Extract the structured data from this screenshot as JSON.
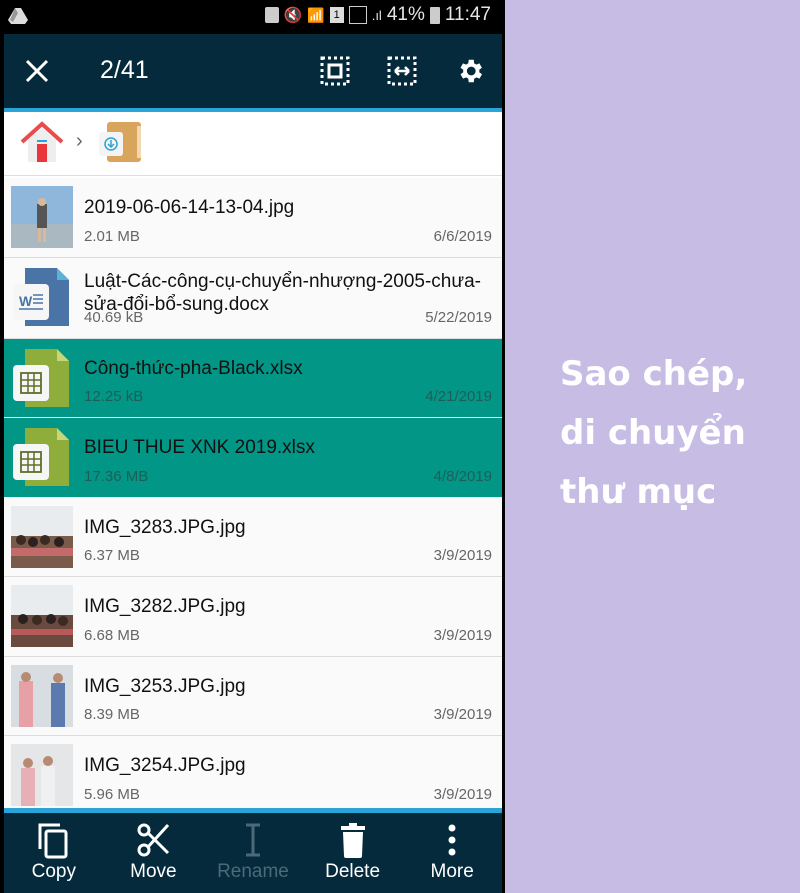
{
  "status_bar": {
    "battery": "41%",
    "time": "11:47"
  },
  "toolbar": {
    "counter": "2/41"
  },
  "files": [
    {
      "name": "2019-06-06-14-13-04.jpg",
      "size": "2.01 MB",
      "date": "6/6/2019",
      "type": "image",
      "selected": false
    },
    {
      "name": "Luật-Các-công-cụ-chuyển-nhượng-2005-chưa-sửa-đổi-bổ-sung.docx",
      "size": "40.69 kB",
      "date": "5/22/2019",
      "type": "word",
      "selected": false
    },
    {
      "name": "Công-thức-pha-Black.xlsx",
      "size": "12.25 kB",
      "date": "4/21/2019",
      "type": "excel",
      "selected": true
    },
    {
      "name": "BIEU THUE XNK 2019.xlsx",
      "size": "17.36 MB",
      "date": "4/8/2019",
      "type": "excel",
      "selected": true
    },
    {
      "name": "IMG_3283.JPG.jpg",
      "size": "6.37 MB",
      "date": "3/9/2019",
      "type": "image",
      "selected": false
    },
    {
      "name": "IMG_3282.JPG.jpg",
      "size": "6.68 MB",
      "date": "3/9/2019",
      "type": "image",
      "selected": false
    },
    {
      "name": "IMG_3253.JPG.jpg",
      "size": "8.39 MB",
      "date": "3/9/2019",
      "type": "image",
      "selected": false
    },
    {
      "name": "IMG_3254.JPG.jpg",
      "size": "5.96 MB",
      "date": "3/9/2019",
      "type": "image",
      "selected": false
    }
  ],
  "actions": [
    {
      "label": "Copy",
      "icon": "copy-icon",
      "enabled": true
    },
    {
      "label": "Move",
      "icon": "scissors-icon",
      "enabled": true
    },
    {
      "label": "Rename",
      "icon": "text-cursor-icon",
      "enabled": false
    },
    {
      "label": "Delete",
      "icon": "trash-icon",
      "enabled": true
    },
    {
      "label": "More",
      "icon": "more-vertical-icon",
      "enabled": true
    }
  ],
  "caption": {
    "line1": "Sao chép,",
    "line2": "di chuyển",
    "line3": "thư mục"
  },
  "colors": {
    "toolbar": "#052a3c",
    "accent": "#2aa4d7",
    "selected": "#029686",
    "background": "#c6bce4"
  }
}
